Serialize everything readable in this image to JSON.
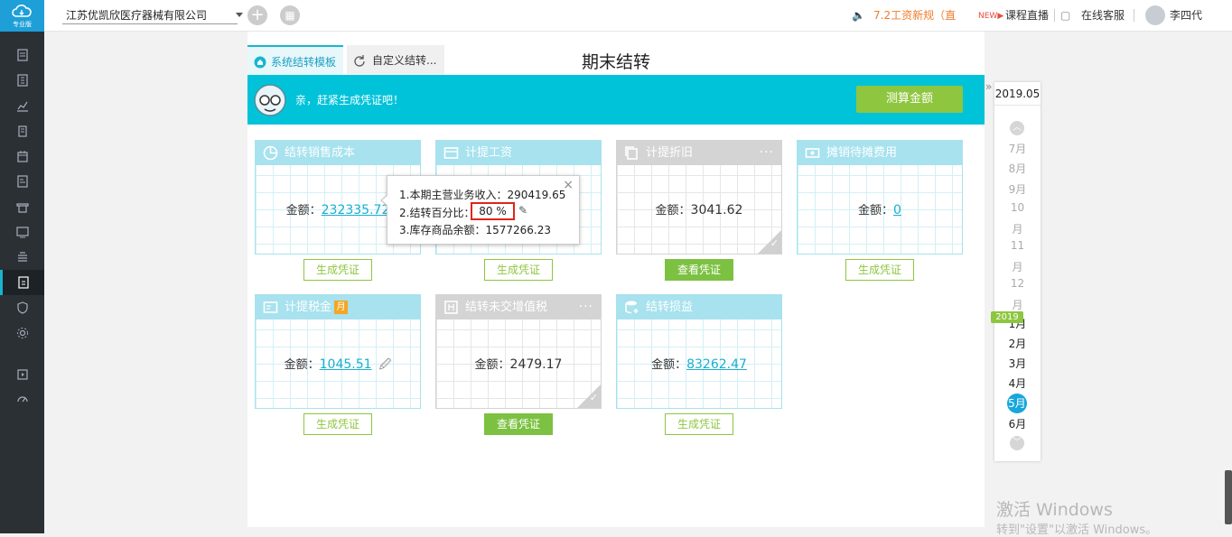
{
  "app": {
    "logo_label": "专业版",
    "company": "江苏优凯欣医疗器械有限公司",
    "news": "7.2工资新规（直",
    "live": "课程直播",
    "support": "在线客服",
    "user": "李四代"
  },
  "tabs": [
    "系统结转模板",
    "自定义结转..."
  ],
  "page_title": "期末结转",
  "banner": {
    "text": "亲，赶紧生成凭证吧！",
    "button": "测算金额"
  },
  "cards": [
    {
      "title": "结转销售成本",
      "amount_label": "金额：",
      "amount": "232335.72",
      "button": "生成凭证"
    },
    {
      "title": "计提工资",
      "amount_label": "",
      "amount": "",
      "button": "生成凭证"
    },
    {
      "title": "计提折旧",
      "amount_label": "金额：",
      "amount": "3041.62",
      "button": "查看凭证"
    },
    {
      "title": "摊销待摊费用",
      "amount_label": "金额：",
      "amount": "0",
      "button": "生成凭证"
    },
    {
      "title": "计提税金",
      "badge": "月",
      "amount_label": "金额：",
      "amount": "1045.51",
      "button": "生成凭证"
    },
    {
      "title": "结转未交增值税",
      "amount_label": "金额：",
      "amount": "2479.17",
      "button": "查看凭证"
    },
    {
      "title": "结转损益",
      "amount_label": "金额：",
      "amount": "83262.47",
      "button": "生成凭证"
    }
  ],
  "popover": {
    "line1": "1.本期主营业务收入：290419.65",
    "line2_label": "2.结转百分比：",
    "percent": "80   %",
    "line3": "3.库存商品余额：1577266.23",
    "close": "×"
  },
  "period": {
    "year_label": "2019.05",
    "months_prev": [
      "7月",
      "8月",
      "9月",
      "10",
      "月",
      "11",
      "月",
      "12",
      "月"
    ],
    "year_badge": "2019",
    "months_cur": [
      "1月",
      "2月",
      "3月",
      "4月",
      "5月",
      "6月"
    ],
    "selected": "5月"
  },
  "watermark": {
    "line1": "激活 Windows",
    "line2": "转到\"设置\"以激活 Windows。"
  }
}
